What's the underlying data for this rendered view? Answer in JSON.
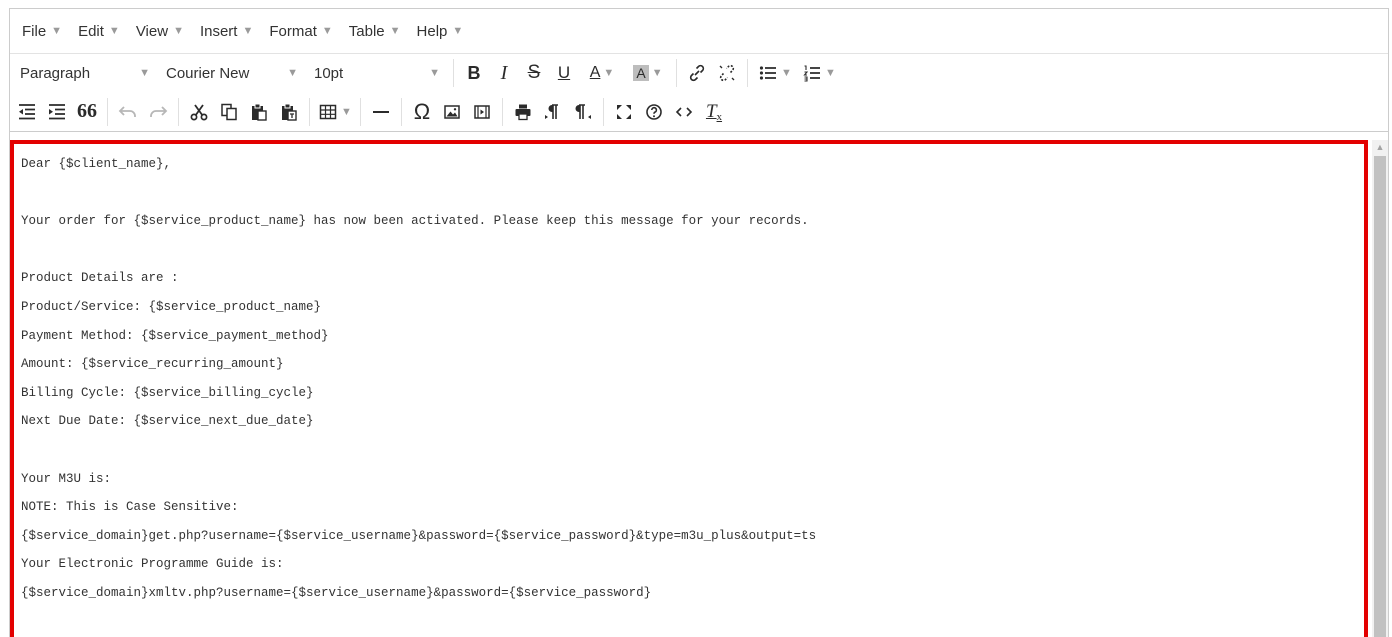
{
  "menubar": {
    "items": [
      {
        "label": "File"
      },
      {
        "label": "Edit"
      },
      {
        "label": "View"
      },
      {
        "label": "Insert"
      },
      {
        "label": "Format"
      },
      {
        "label": "Table"
      },
      {
        "label": "Help"
      }
    ]
  },
  "toolbar": {
    "block_format": "Paragraph",
    "font_family": "Courier New",
    "font_size": "10pt",
    "bold": "B",
    "italic": "I",
    "strikethrough": "S",
    "underline": "U",
    "text_color": "A",
    "background_color": "A",
    "blockquote": "66",
    "special_char": "Ω",
    "clear_formatting": "T"
  },
  "colors": {
    "highlight_border": "#e30000",
    "toolbar_icon": "#2b2b2b",
    "disabled_icon": "#b7b7b7"
  },
  "content": {
    "lines": [
      "Dear {$client_name},",
      "",
      "Your order for {$service_product_name} has now been activated. Please keep this message for your records.",
      "",
      "Product Details are :",
      "Product/Service: {$service_product_name}",
      "Payment Method: {$service_payment_method}",
      "Amount: {$service_recurring_amount}",
      "Billing Cycle: {$service_billing_cycle}",
      "Next Due Date: {$service_next_due_date}",
      "",
      "Your M3U is:",
      "NOTE: This is Case Sensitive:",
      "{$service_domain}get.php?username={$service_username}&password={$service_password}&type=m3u_plus&output=ts",
      "Your Electronic Programme Guide is:",
      "{$service_domain}xmltv.php?username={$service_username}&password={$service_password}"
    ]
  }
}
